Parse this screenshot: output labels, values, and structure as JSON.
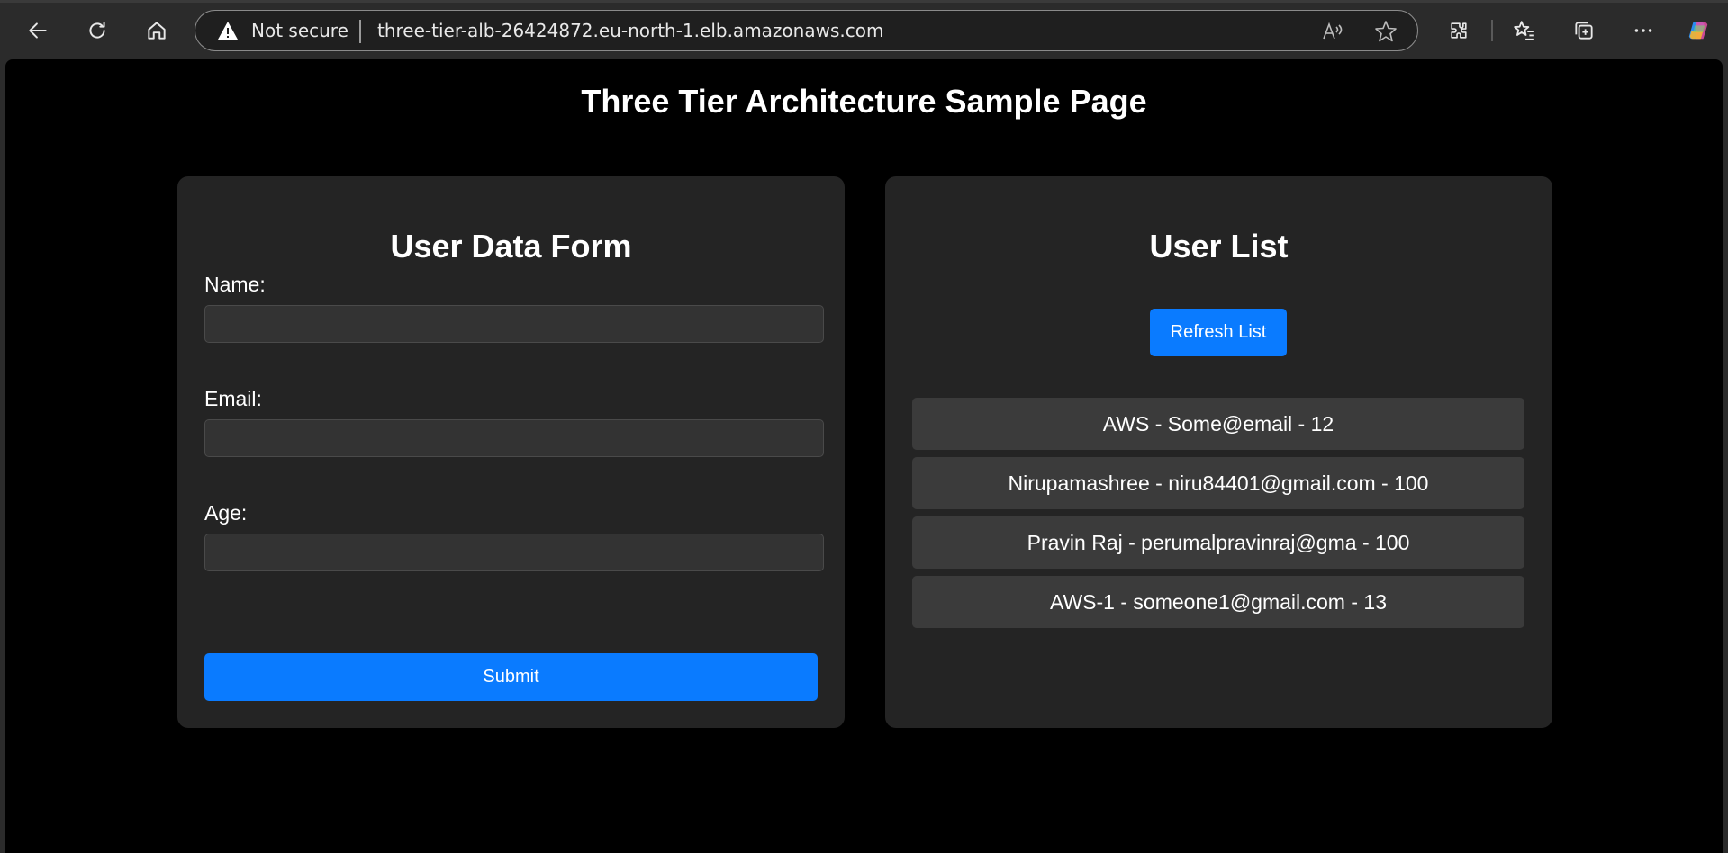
{
  "browser": {
    "security_label": "Not secure",
    "url": "three-tier-alb-26424872.eu-north-1.elb.amazonaws.com"
  },
  "page": {
    "title": "Three Tier Architecture Sample Page"
  },
  "form": {
    "heading": "User Data Form",
    "name_label": "Name:",
    "name_value": "",
    "email_label": "Email:",
    "email_value": "",
    "age_label": "Age:",
    "age_value": "",
    "submit_label": "Submit"
  },
  "user_list": {
    "heading": "User List",
    "refresh_label": "Refresh List",
    "items": [
      "AWS - Some@email - 12",
      "Nirupamashree - niru84401@gmail.com - 100",
      "Pravin Raj - perumalpravinraj@gma - 100",
      "AWS-1 - someone1@gmail.com - 13"
    ]
  },
  "colors": {
    "accent": "#0a7bff",
    "card_bg": "#242424",
    "page_bg": "#000000",
    "item_bg": "#3b3b3b"
  },
  "icons": [
    "back-icon",
    "reload-icon",
    "home-icon",
    "warning-icon",
    "read-aloud-icon",
    "favorite-star-icon",
    "extensions-icon",
    "favorites-icon",
    "collections-icon",
    "more-icon",
    "copilot-icon"
  ]
}
